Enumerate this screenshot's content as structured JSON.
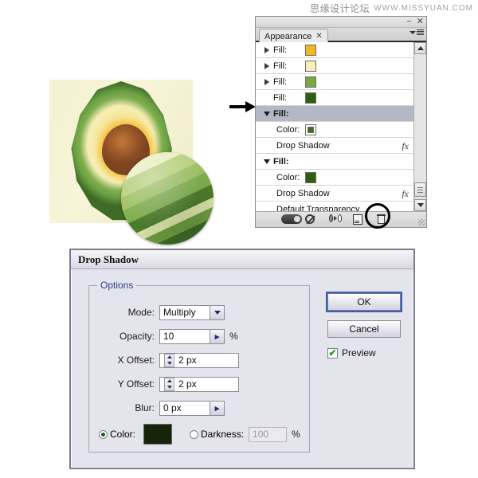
{
  "watermark": {
    "cn": "思缘设计论坛",
    "en": "WWW.MISSYUAN.COM"
  },
  "artwork": {
    "name": "avocado-illustration",
    "magnifier_label": "avocado-skin-detail-magnifier"
  },
  "appearance_panel": {
    "tab_label": "Appearance",
    "tab_close": "✕",
    "window_minimize": "−",
    "window_close": "✕",
    "rows": [
      {
        "label": "Fill:",
        "disclosure": "right",
        "swatch": "#f0ba1f",
        "fx": "",
        "selected": false,
        "indent": false
      },
      {
        "label": "Fill:",
        "disclosure": "right",
        "swatch": "#f7edb6",
        "fx": "",
        "selected": false,
        "indent": false
      },
      {
        "label": "Fill:",
        "disclosure": "right",
        "swatch": "#7ba83e",
        "fx": "",
        "selected": false,
        "indent": false
      },
      {
        "label": "Fill:",
        "disclosure": "none",
        "swatch": "#2f5e10",
        "fx": "",
        "selected": false,
        "indent": false
      },
      {
        "label": "Fill:",
        "disclosure": "down",
        "swatch": "",
        "fx": "",
        "selected": true,
        "indent": false
      },
      {
        "label": "Color:",
        "disclosure": "none",
        "swatch": "#456b1c",
        "fx": "",
        "selected": false,
        "indent": true,
        "framed": true
      },
      {
        "label": "Drop Shadow",
        "disclosure": "none",
        "swatch": "",
        "fx": "fx",
        "selected": false,
        "indent": true
      },
      {
        "label": "Fill:",
        "disclosure": "down",
        "swatch": "",
        "fx": "",
        "selected": false,
        "indent": false
      },
      {
        "label": "Color:",
        "disclosure": "none",
        "swatch": "#2f5e10",
        "fx": "",
        "selected": false,
        "indent": true
      },
      {
        "label": "Drop Shadow",
        "disclosure": "none",
        "swatch": "",
        "fx": "fx",
        "selected": false,
        "indent": true
      },
      {
        "label": "Default Transparency",
        "disclosure": "none",
        "swatch": "",
        "fx": "",
        "selected": false,
        "indent": true
      }
    ],
    "footer_buttons": [
      "toggle-visibility-button",
      "clear-appearance-button",
      "duplicate-appearance-button",
      "new-art-has-basic-appearance-button",
      "delete-button"
    ]
  },
  "dialog": {
    "title": "Drop Shadow",
    "group_title": "Options",
    "fields": {
      "mode_label": "Mode:",
      "mode_value": "Multiply",
      "opacity_label": "Opacity:",
      "opacity_value": "10",
      "opacity_unit": "%",
      "x_offset_label": "X Offset:",
      "x_offset_value": "2 px",
      "y_offset_label": "Y Offset:",
      "y_offset_value": "2 px",
      "blur_label": "Blur:",
      "blur_value": "0 px",
      "color_label": "Color:",
      "color_value": "#16240a",
      "darkness_label": "Darkness:",
      "darkness_value": "100",
      "darkness_unit": "%"
    },
    "buttons": {
      "ok": "OK",
      "cancel": "Cancel"
    },
    "preview_label": "Preview",
    "preview_check": "✔"
  }
}
